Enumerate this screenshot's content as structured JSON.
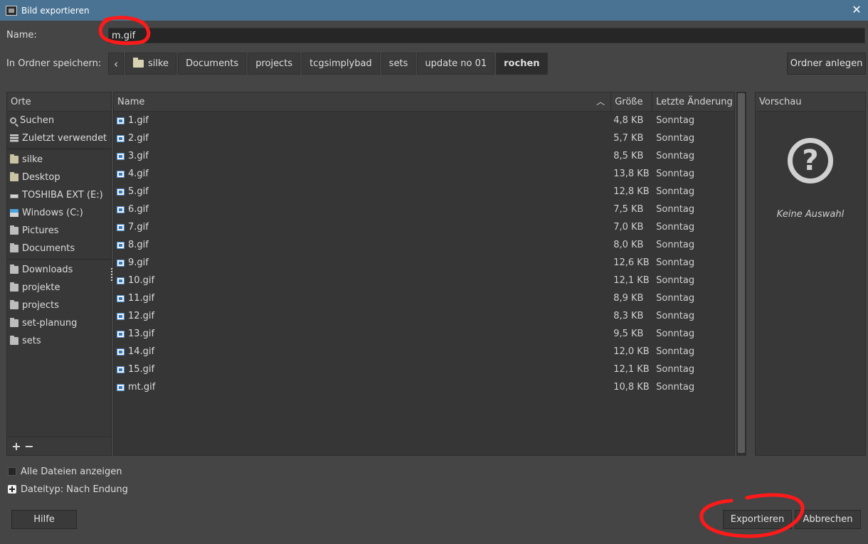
{
  "window": {
    "title": "Bild exportieren"
  },
  "name_field": {
    "label": "Name:",
    "value": "m.gif"
  },
  "folder_path": {
    "label": "In Ordner speichern:",
    "crumbs": [
      "silke",
      "Documents",
      "projects",
      "tcgsimplybad",
      "sets",
      "update no 01",
      "rochen"
    ],
    "create_folder": "Ordner anlegen"
  },
  "places": {
    "header": "Orte",
    "items": [
      {
        "label": "Suchen",
        "icon": "search-icon"
      },
      {
        "label": "Zuletzt verwendet",
        "icon": "recent-icon"
      },
      {
        "label": "silke",
        "icon": "folder-icon"
      },
      {
        "label": "Desktop",
        "icon": "folder-icon"
      },
      {
        "label": "TOSHIBA EXT (E:)",
        "icon": "drive-icon"
      },
      {
        "label": "Windows (C:)",
        "icon": "windows-drive-icon"
      },
      {
        "label": "Pictures",
        "icon": "folder-icon"
      },
      {
        "label": "Documents",
        "icon": "folder-icon"
      },
      {
        "label": "Downloads",
        "icon": "folder-icon"
      },
      {
        "label": "projekte",
        "icon": "folder-icon"
      },
      {
        "label": "projects",
        "icon": "folder-icon"
      },
      {
        "label": "set-planung",
        "icon": "folder-icon"
      },
      {
        "label": "sets",
        "icon": "folder-icon"
      }
    ],
    "add": "+",
    "remove": "−"
  },
  "files": {
    "columns": {
      "name": "Name",
      "size": "Größe",
      "date": "Letzte Änderung"
    },
    "rows": [
      {
        "name": "1.gif",
        "size": "4,8 KB",
        "date": "Sonntag"
      },
      {
        "name": "2.gif",
        "size": "5,7 KB",
        "date": "Sonntag"
      },
      {
        "name": "3.gif",
        "size": "8,5 KB",
        "date": "Sonntag"
      },
      {
        "name": "4.gif",
        "size": "13,8 KB",
        "date": "Sonntag"
      },
      {
        "name": "5.gif",
        "size": "12,8 KB",
        "date": "Sonntag"
      },
      {
        "name": "6.gif",
        "size": "7,5 KB",
        "date": "Sonntag"
      },
      {
        "name": "7.gif",
        "size": "7,0 KB",
        "date": "Sonntag"
      },
      {
        "name": "8.gif",
        "size": "8,0 KB",
        "date": "Sonntag"
      },
      {
        "name": "9.gif",
        "size": "12,6 KB",
        "date": "Sonntag"
      },
      {
        "name": "10.gif",
        "size": "12,1 KB",
        "date": "Sonntag"
      },
      {
        "name": "11.gif",
        "size": "8,9 KB",
        "date": "Sonntag"
      },
      {
        "name": "12.gif",
        "size": "8,3 KB",
        "date": "Sonntag"
      },
      {
        "name": "13.gif",
        "size": "9,5 KB",
        "date": "Sonntag"
      },
      {
        "name": "14.gif",
        "size": "12,0 KB",
        "date": "Sonntag"
      },
      {
        "name": "15.gif",
        "size": "12,1 KB",
        "date": "Sonntag"
      },
      {
        "name": "mt.gif",
        "size": "10,8 KB",
        "date": "Sonntag"
      }
    ]
  },
  "preview": {
    "header": "Vorschau",
    "empty": "Keine Auswahl"
  },
  "options": {
    "show_all": "Alle Dateien anzeigen",
    "filetype": "Dateityp: Nach Endung"
  },
  "buttons": {
    "help": "Hilfe",
    "export": "Exportieren",
    "cancel": "Abbrechen"
  },
  "colors": {
    "titlebar": "#4a7393",
    "annotation": "#ff1a1a",
    "background": "#454545"
  }
}
